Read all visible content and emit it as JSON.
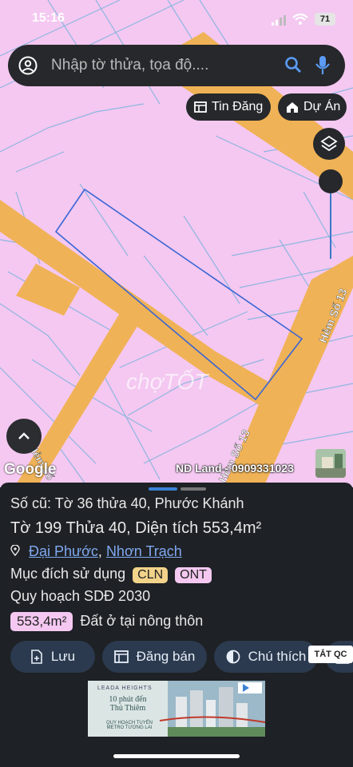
{
  "status_bar": {
    "time": "15:16",
    "battery": "71"
  },
  "search": {
    "placeholder": "Nhập tờ thửa, tọa độ...."
  },
  "top_buttons": {
    "tin_dang": "Tin Đăng",
    "du_an": "Dự Án"
  },
  "map": {
    "road_labels": [
      "Hẻm Số 13",
      "Hẻm Số 13",
      "Hẻm Số"
    ],
    "watermark": "chợTỐT",
    "google": "Google",
    "credit": "ND Land - 0909331023"
  },
  "parcel": {
    "old_info": "Số cũ: Tờ 36 thửa 40, Phước Khánh",
    "to_label": "Tờ",
    "to_value": "199",
    "thua_label": "Thửa",
    "thua_value": "40",
    "area_label": ", Diện tích",
    "area_value": "553,4m²",
    "ward": "Đại Phước",
    "separator": ",",
    "district": "Nhơn Trạch",
    "land_use_label": "Mục đích sử dụng",
    "land_use_tags": [
      "CLN",
      "ONT"
    ],
    "plan_label": "Quy hoạch SDĐ 2030",
    "plan_area": "553,4m²",
    "plan_type": "Đất ở tại nông thôn"
  },
  "actions": {
    "save": "Lưu",
    "post": "Đăng bán",
    "note": "Chú thích",
    "hide_ad": "TẮT QC"
  },
  "ad": {
    "brand": "LEADA HEIGHTS",
    "headline": "10 phút đến Thủ Thiêm",
    "sub": "QUY HOẠCH TUYẾN METRO TƯƠNG LAI"
  },
  "colors": {
    "residential": "#f4c8f1",
    "road": "#f0b256",
    "panel": "#1e2125",
    "button": "#2b3a4e"
  }
}
